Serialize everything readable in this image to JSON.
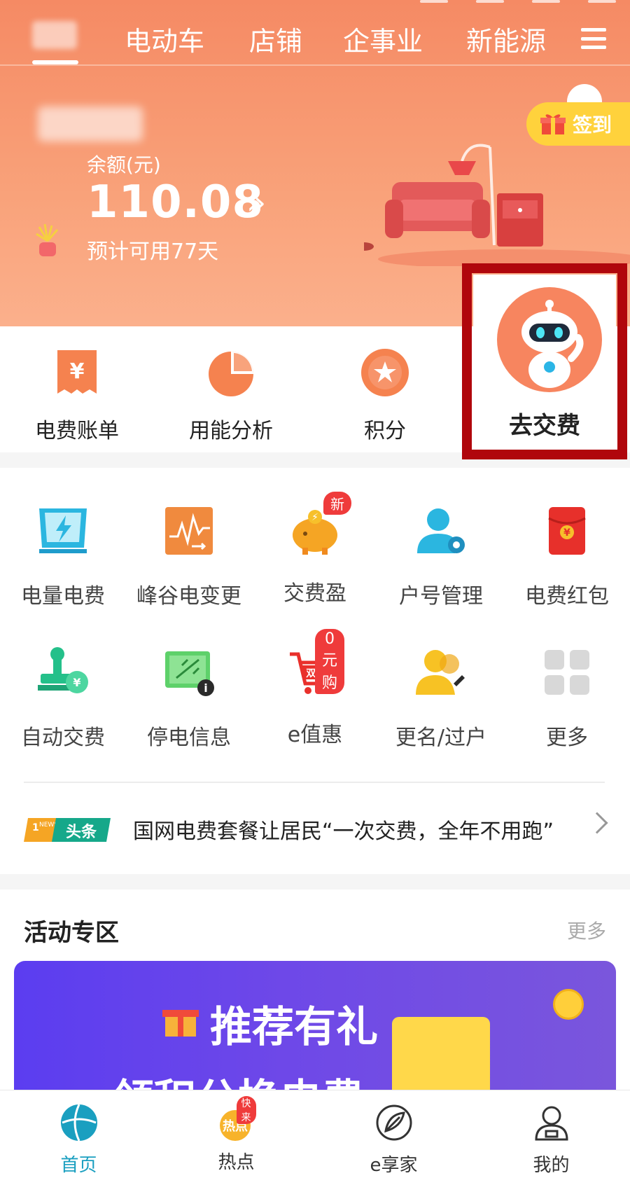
{
  "nav": {
    "tabs": [
      "电动车",
      "店铺",
      "企事业",
      "新能源"
    ]
  },
  "account": {
    "balance_label": "余额(元)",
    "balance_value": "110.08",
    "days_label": "预计可用77天"
  },
  "signin": {
    "label": "签到"
  },
  "quick": {
    "items": [
      "电费账单",
      "用能分析",
      "积分",
      "去交费"
    ]
  },
  "services": {
    "items": [
      {
        "label": "电量电费"
      },
      {
        "label": "峰谷电变更"
      },
      {
        "label": "交费盈",
        "badge": "新"
      },
      {
        "label": "户号管理"
      },
      {
        "label": "电费红包"
      },
      {
        "label": "自动交费"
      },
      {
        "label": "停电信息"
      },
      {
        "label": "e值惠",
        "badge": "0元购"
      },
      {
        "label": "更名/过户"
      },
      {
        "label": "更多"
      }
    ]
  },
  "news": {
    "logo_text": "头条",
    "headline": "国网电费套餐让居民“一次交费，全年不用跑”"
  },
  "activity": {
    "title": "活动专区",
    "more": "更多",
    "banner_line1": "推荐有礼",
    "banner_line2": "领积分换电费"
  },
  "tabbar": {
    "items": [
      "首页",
      "热点",
      "e享家",
      "我的"
    ],
    "hot_badge": "快来"
  },
  "colors": {
    "hero_orange": "#f58a64",
    "accent_red": "#b0060c",
    "tab_active": "#1a9fc0"
  }
}
